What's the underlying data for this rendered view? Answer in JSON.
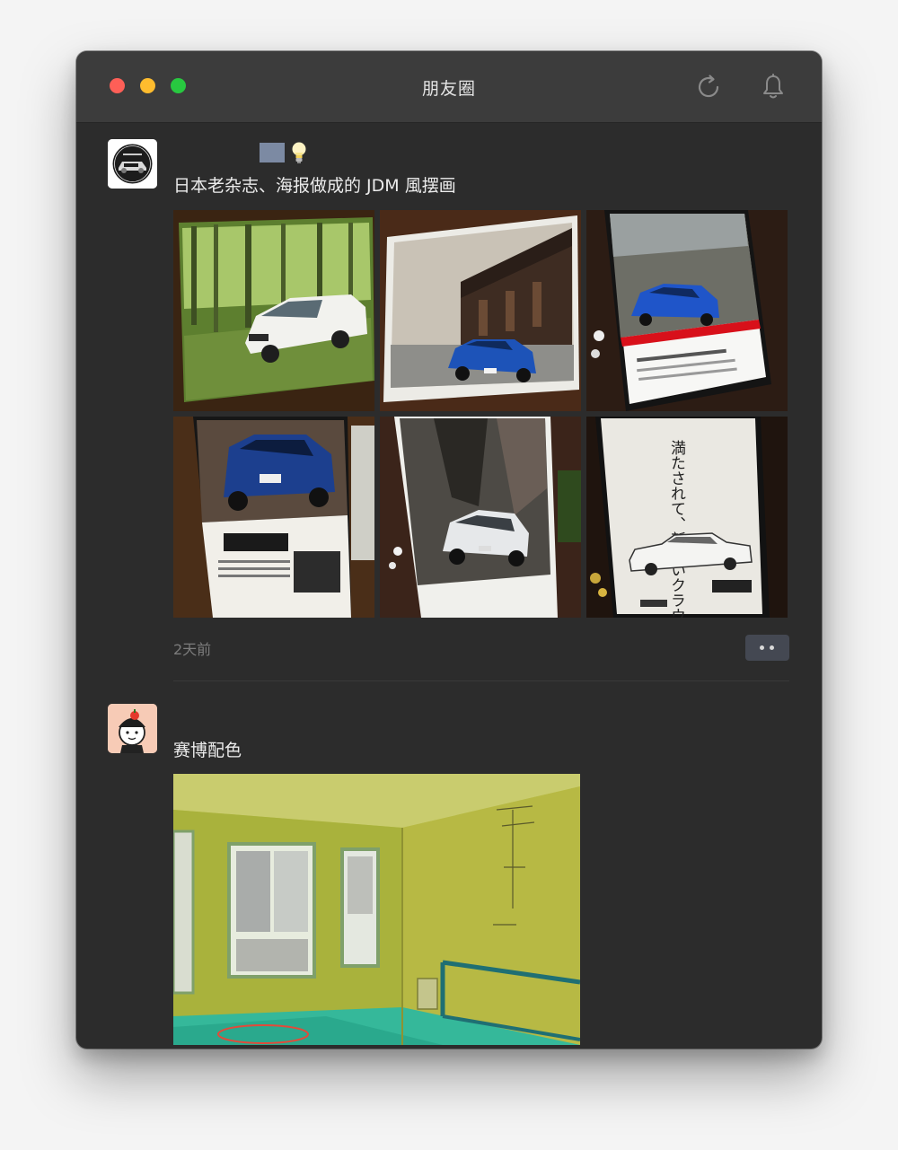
{
  "window": {
    "title": "朋友圈",
    "refresh_icon": "refresh-icon",
    "bell_icon": "bell-icon"
  },
  "posts": [
    {
      "name_emoji": "lightbulb-icon",
      "text": "日本老杂志、海报做成的 JDM 風摆画",
      "images": [
        "green-forest-white-suv-poster",
        "blue-car-old-street-poster",
        "blue-sedan-magazine-page",
        "blue-suv-magazine-spread",
        "white-hatchback-forest-poster",
        "japanese-crown-sedan-ad"
      ],
      "time": "2天前",
      "more_icon": "more-dots-icon"
    },
    {
      "text": "赛博配色",
      "images": [
        "green-room-interior-photo"
      ]
    }
  ],
  "ad_text": {
    "headline": "満たされて、新しいクラウン。"
  },
  "colors": {
    "window_bg": "#2c2c2c",
    "titlebar_bg": "#3c3c3c",
    "traffic_red": "#fe5f57",
    "traffic_yellow": "#febc2e",
    "traffic_green": "#28c840"
  }
}
